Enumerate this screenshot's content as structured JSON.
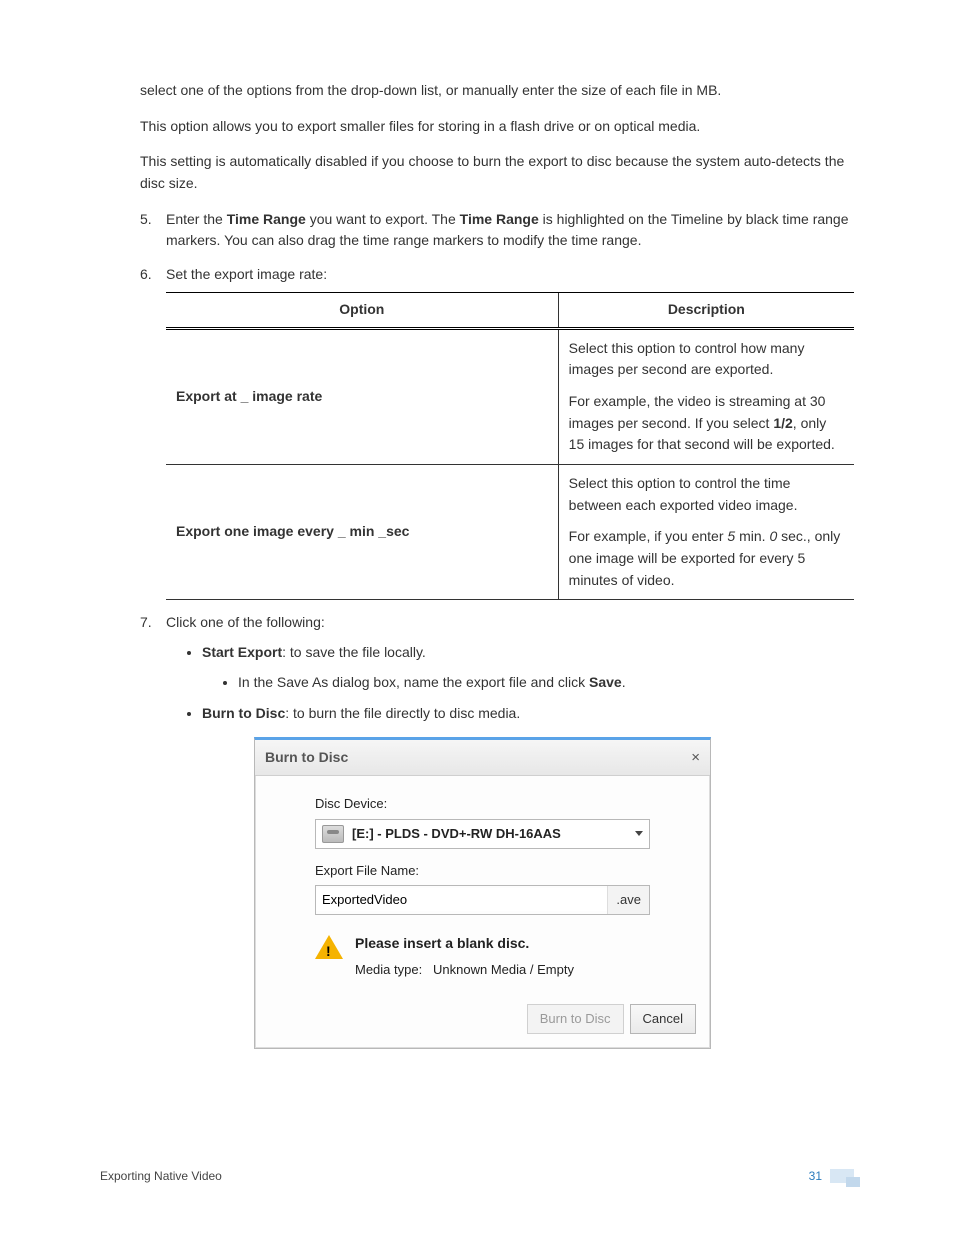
{
  "intro": {
    "p1": "select one of the options from the drop-down list, or manually enter the size of each file in MB.",
    "p2": "This option allows you to export smaller files for storing in a flash drive or on optical media.",
    "p3": "This setting is automatically disabled if you choose to burn the export to disc because the system auto-detects the disc size."
  },
  "steps": {
    "s5": {
      "num": "5.",
      "a": "Enter the ",
      "b": "Time Range",
      "c": " you want to export. The ",
      "d": "Time Range",
      "e": " is highlighted on the Timeline by black time range markers. You can also drag the time range markers to modify the time range."
    },
    "s6": {
      "num": "6.",
      "text": "Set the export image rate:",
      "table": {
        "h1": "Option",
        "h2": "Description",
        "r1": {
          "opt": "Export at _ image rate",
          "d1": "Select this option to control how many images per second are exported.",
          "d2a": "For example, the video is streaming at 30 images per second. If you select ",
          "d2b": "1/2",
          "d2c": ", only 15 images for that second will be exported."
        },
        "r2": {
          "opt": "Export one image every _ min _sec",
          "d1": "Select this option to control the time between each exported video image.",
          "d2a": "For example, if you enter ",
          "d2b": "5",
          "d2c": " min. ",
          "d2d": "0",
          "d2e": " sec., only one image will be exported for every 5 minutes of video."
        }
      }
    },
    "s7": {
      "num": "7.",
      "text": "Click one of the following:",
      "b1": {
        "t": "Start Export",
        "rest": ": to save the file locally."
      },
      "b1_sub_a": "In the Save As dialog box, name the export file and click ",
      "b1_sub_b": "Save",
      "b1_sub_c": ".",
      "b2": {
        "t": "Burn to Disc",
        "rest": ": to burn the file directly to disc media."
      }
    }
  },
  "dialog": {
    "title": "Burn to Disc",
    "close": "×",
    "disc_label": "Disc Device:",
    "disc_value": "[E:] - PLDS - DVD+-RW DH-16AAS",
    "file_label": "Export File Name:",
    "file_value": "ExportedVideo",
    "file_ext": ".ave",
    "warn_title": "Please insert a blank disc.",
    "warn_media_label": "Media type:",
    "warn_media_value": "Unknown Media / Empty",
    "btn_primary": "Burn to Disc",
    "btn_cancel": "Cancel"
  },
  "footer": {
    "section": "Exporting Native Video",
    "page": "31"
  }
}
